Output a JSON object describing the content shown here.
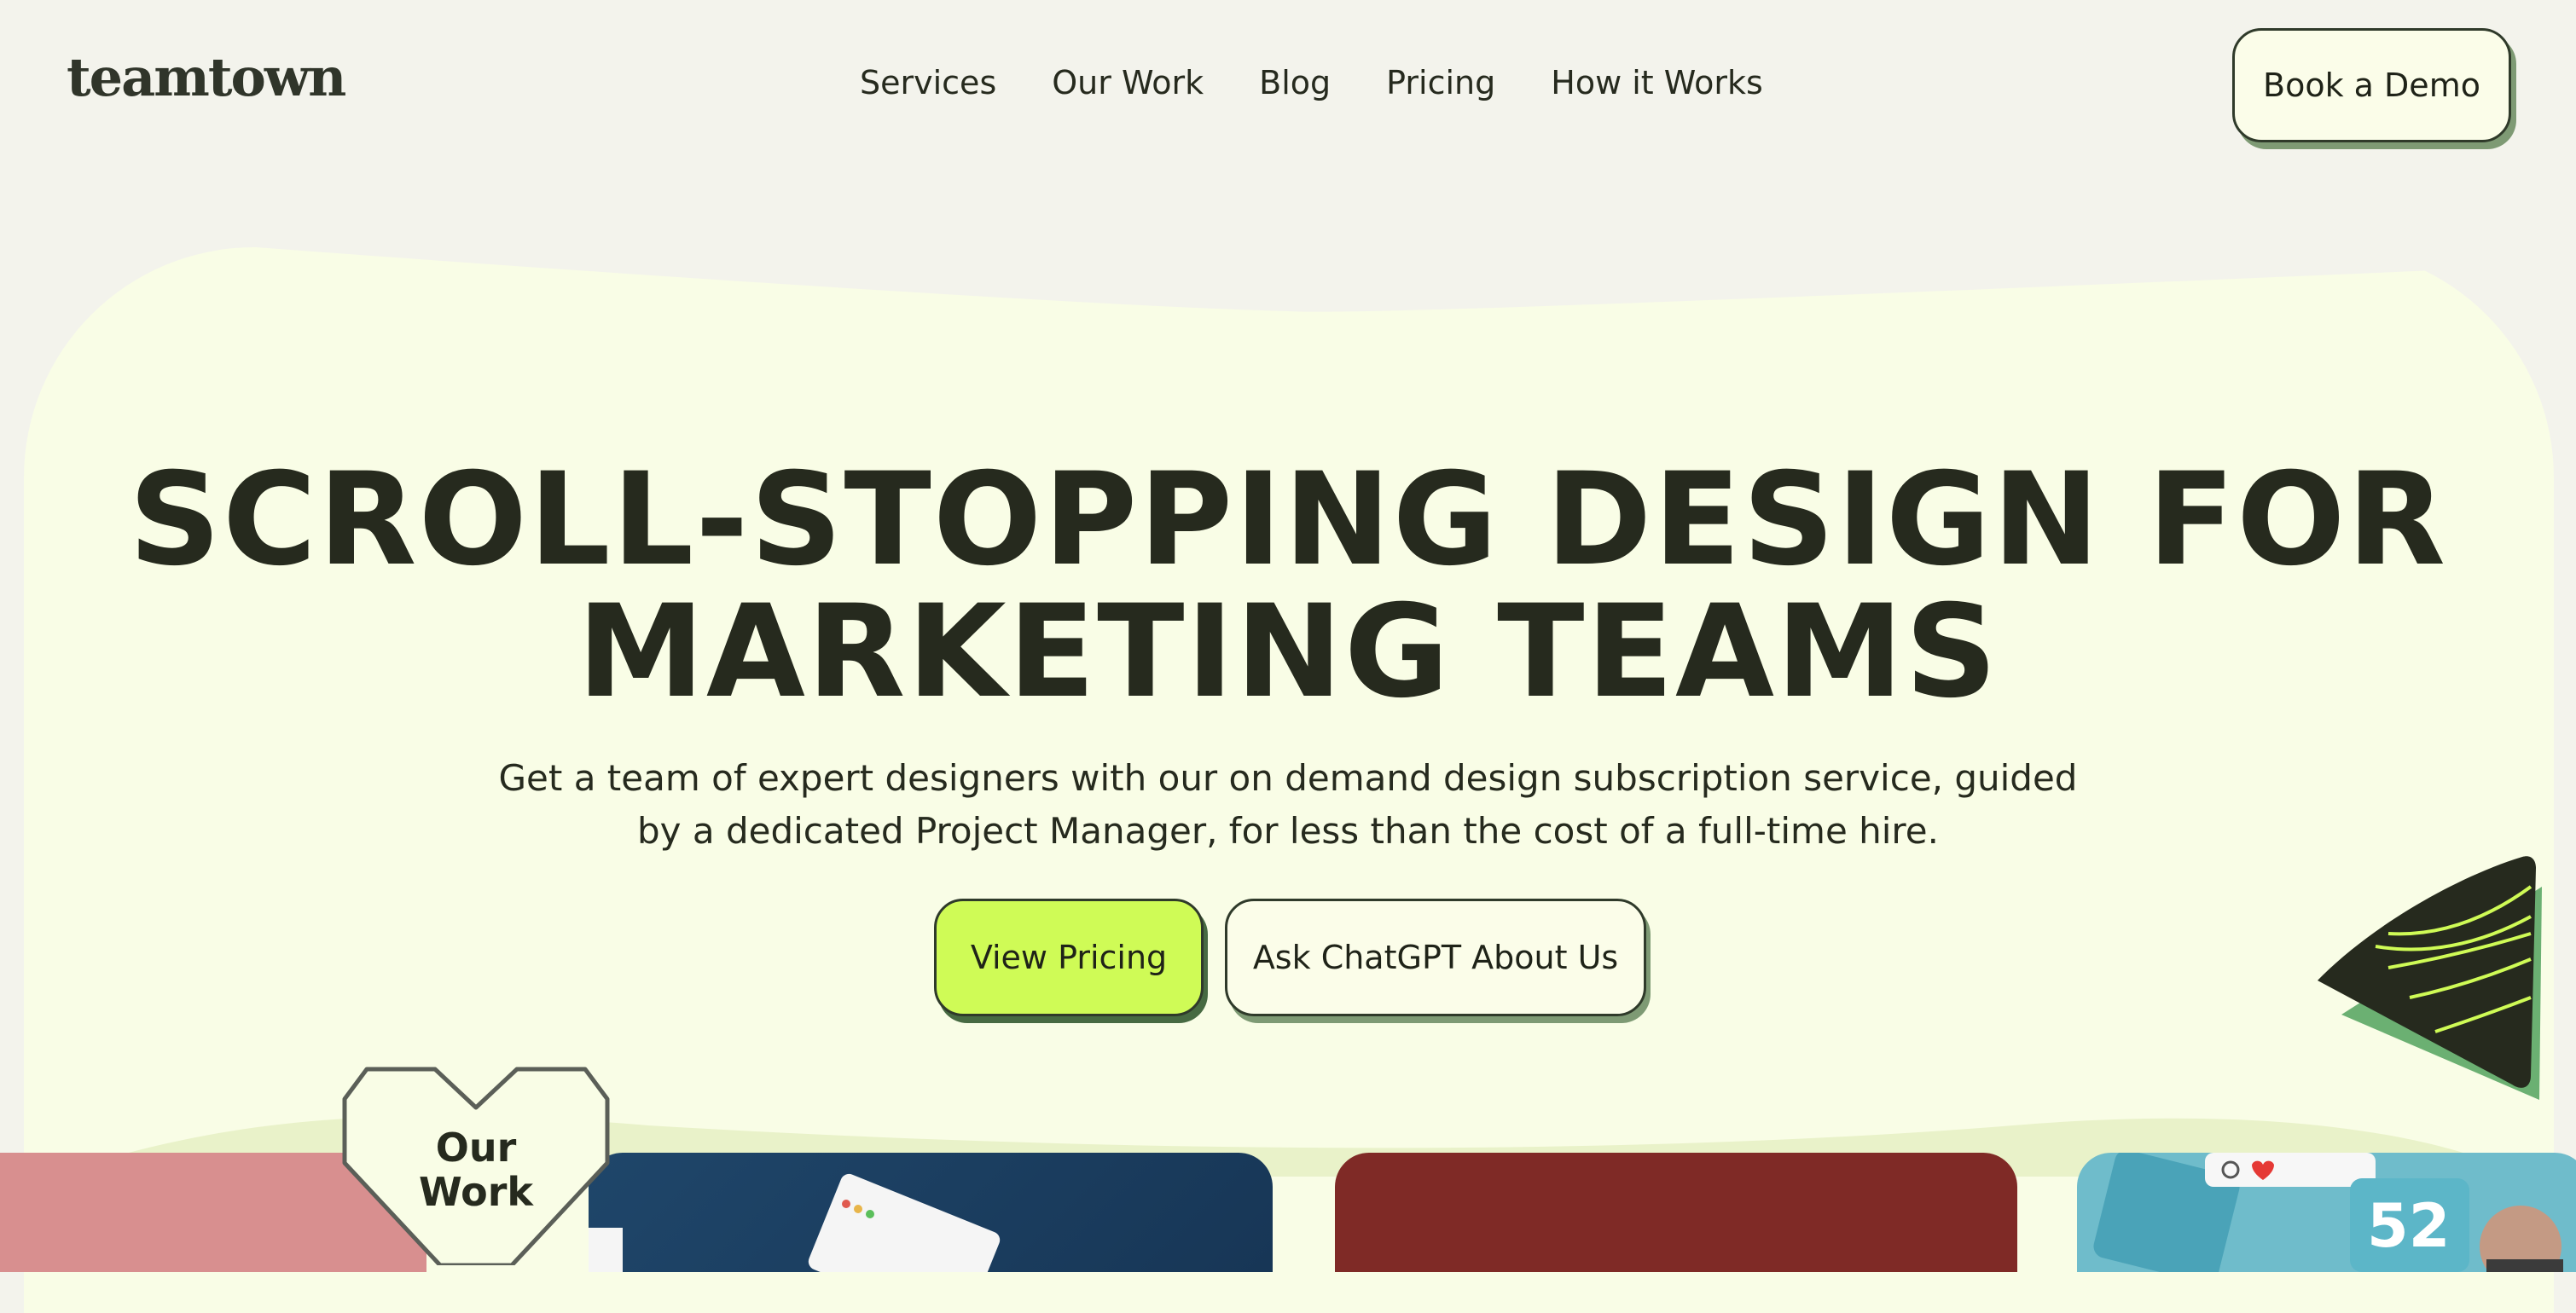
{
  "header": {
    "logo": "teamtown",
    "nav": [
      "Services",
      "Our Work",
      "Blog",
      "Pricing",
      "How it Works"
    ],
    "cta": "Book a Demo"
  },
  "hero": {
    "title_lines": [
      "SCROLL-STOPPING DESIGN FOR",
      "MARKETING TEAMS"
    ],
    "subtitle_lines": [
      "Get a team of expert designers with our on demand design subscription service, guided",
      "by a dedicated Project Manager, for less than the cost of a full-time hire."
    ],
    "primary_button": "View Pricing",
    "secondary_button": "Ask ChatGPT About Us"
  },
  "work": {
    "badge_lines": [
      "Our",
      "Work"
    ],
    "card_number": "52"
  },
  "colors": {
    "page_bg": "#f3f3ec",
    "hero_bg": "#f9fde6",
    "text": "#262a1e",
    "accent_lime": "#cffb56",
    "shadow_green": "#7e9a74",
    "deco_green": "#6bb072",
    "card_pink": "#d88f8f",
    "card_navy": "#1f466a",
    "card_red": "#7f2a26",
    "card_teal": "#6fbccb"
  }
}
